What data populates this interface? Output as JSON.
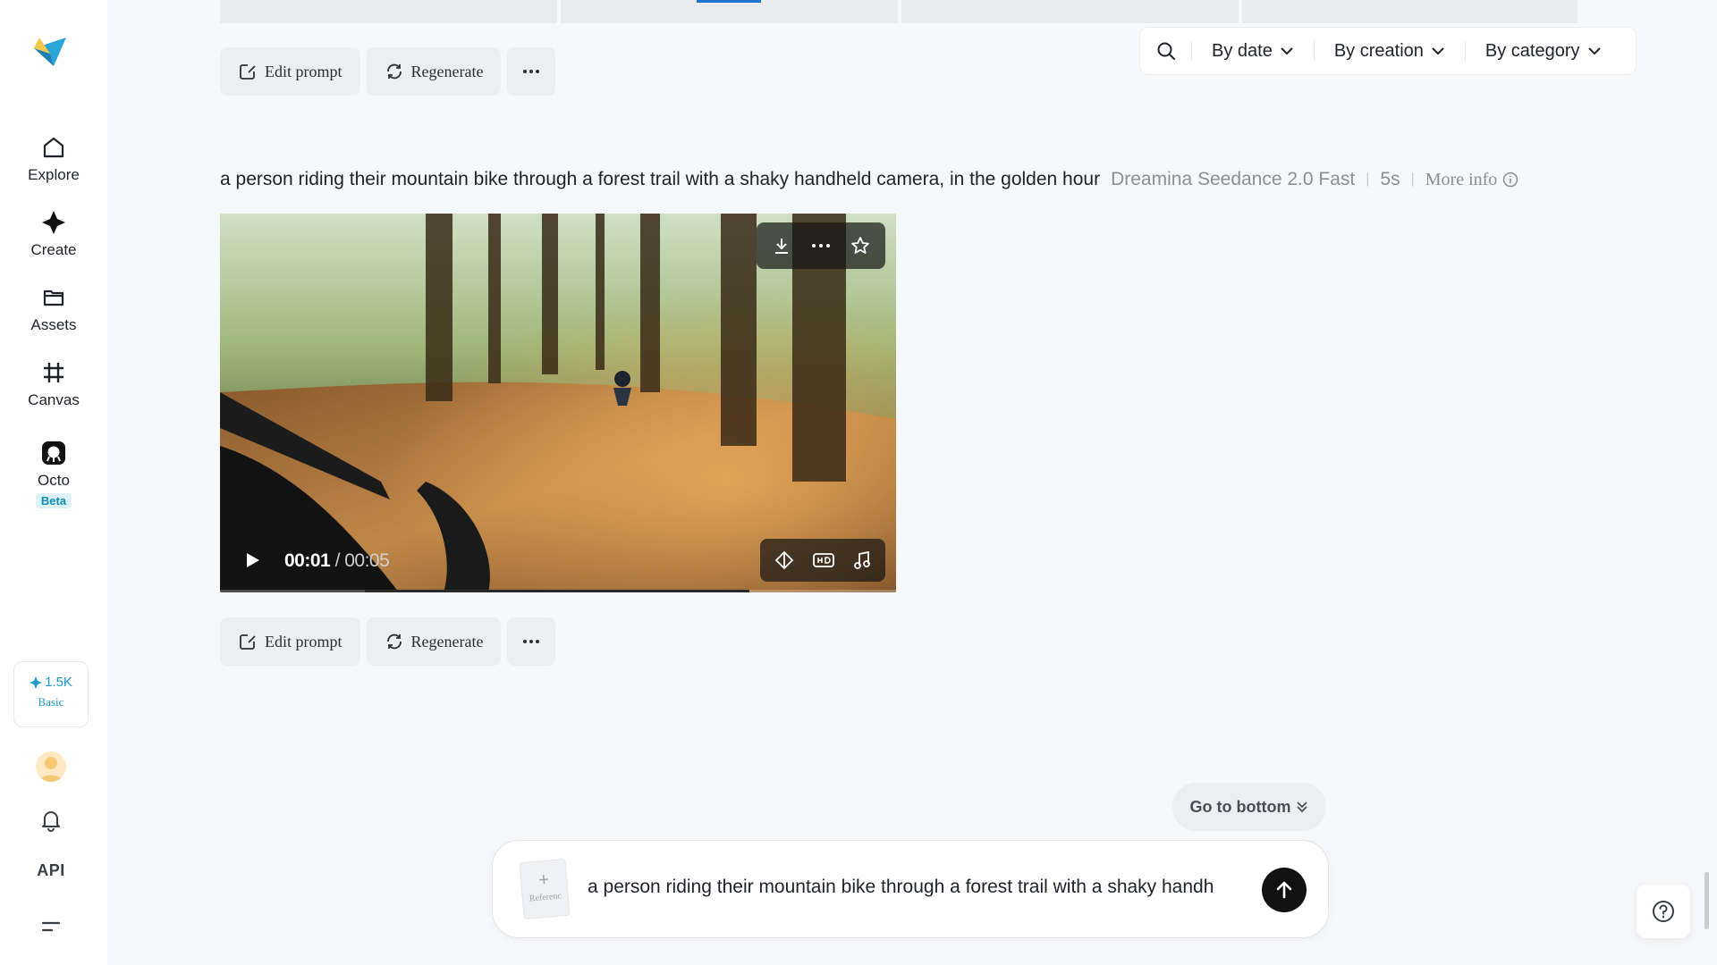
{
  "sidebar": {
    "items": [
      {
        "label": "Explore",
        "icon": "home-icon"
      },
      {
        "label": "Create",
        "icon": "sparkle-icon"
      },
      {
        "label": "Assets",
        "icon": "folder-icon"
      },
      {
        "label": "Canvas",
        "icon": "canvas-icon"
      },
      {
        "label": "Octo",
        "icon": "octo-icon",
        "badge": "Beta"
      }
    ],
    "credits": {
      "amount": "1.5K",
      "tier": "Basic"
    },
    "api_label": "API"
  },
  "filters": {
    "by_date": "By date",
    "by_creation": "By creation",
    "by_category": "By category"
  },
  "actions": {
    "edit_prompt": "Edit prompt",
    "regenerate": "Regenerate",
    "more": "···"
  },
  "generation": {
    "prompt": "a person riding their mountain bike through a forest trail with a shaky handheld camera, in the golden hour",
    "model": "Dreamina Seedance 2.0 Fast",
    "duration": "5s",
    "more_info": "More info",
    "video": {
      "current_time": "00:01",
      "total_time": "/ 00:05"
    }
  },
  "go_to_bottom": "Go to bottom",
  "composer": {
    "reference_label": "Referenc",
    "value": "a person riding their mountain bike through a forest trail with a shaky handh"
  },
  "colors": {
    "accent": "#1a9bc4",
    "send_button": "#111111",
    "beta_badge": "#0b8fb3"
  }
}
